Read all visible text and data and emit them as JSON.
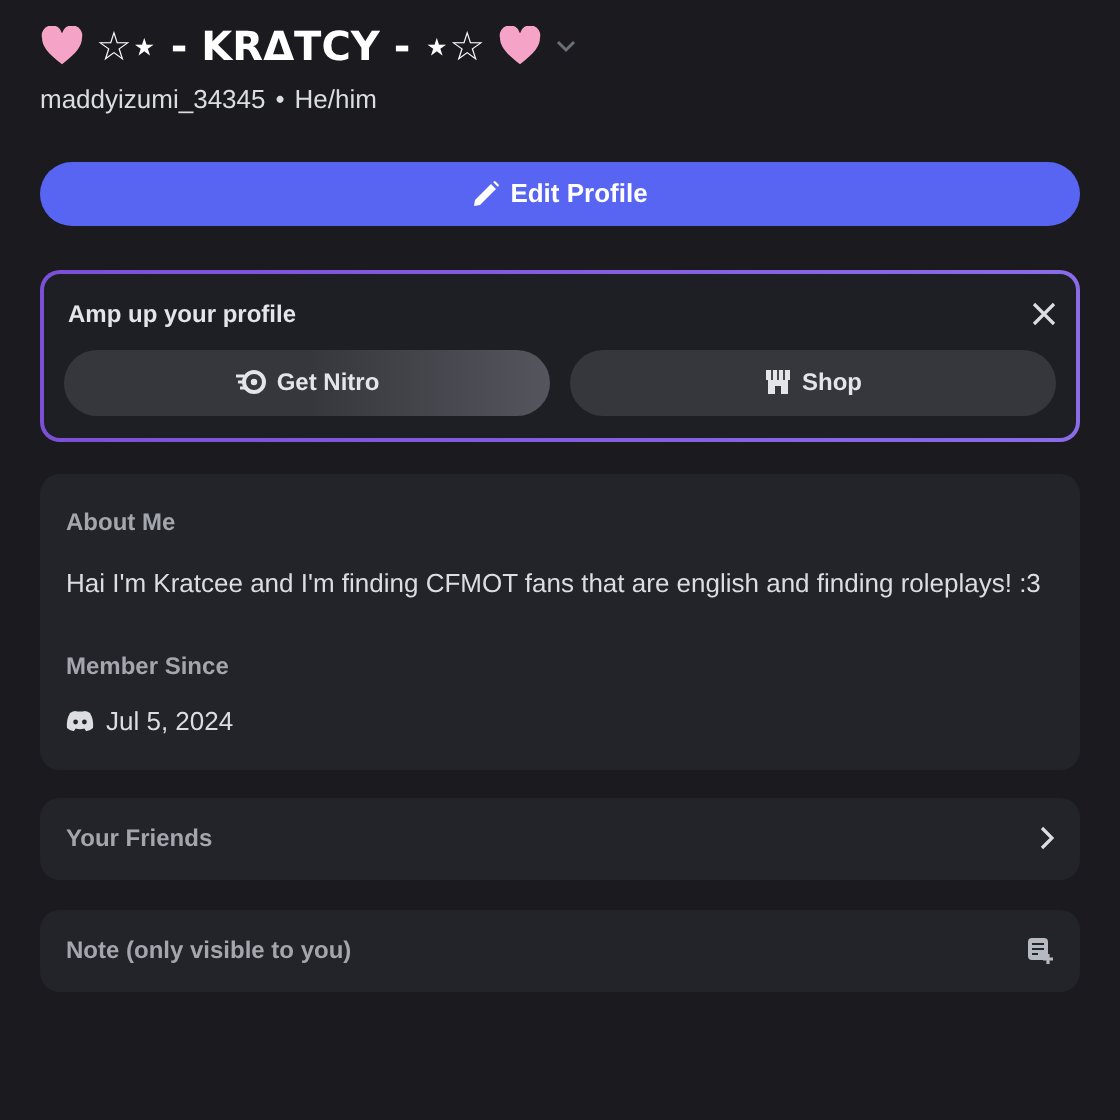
{
  "profile": {
    "display_name": "☆⋆ - KRΔTCY - ⋆☆",
    "username": "maddyizumi_34345",
    "separator": "•",
    "pronouns": "He/him"
  },
  "edit_button": {
    "label": "Edit Profile"
  },
  "promo": {
    "title": "Amp up your profile",
    "buttons": [
      {
        "kind": "nitro",
        "label": "Get Nitro"
      },
      {
        "kind": "shop",
        "label": "Shop"
      }
    ]
  },
  "about": {
    "heading": "About Me",
    "text": "Hai I'm Kratcee and I'm finding CFMOT fans that are english and finding roleplays! :3",
    "member_since_heading": "Member Since",
    "member_since": "Jul 5, 2024"
  },
  "rows": [
    {
      "kind": "friends",
      "label": "Your Friends"
    },
    {
      "kind": "note",
      "label": "Note (only visible to you)"
    }
  ]
}
